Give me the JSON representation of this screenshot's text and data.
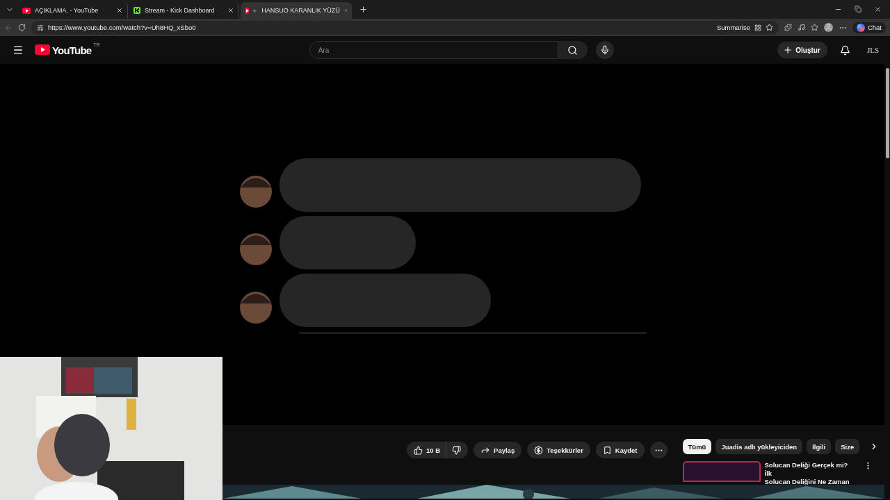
{
  "browser": {
    "tabs": [
      {
        "title": "AÇIKLAMA. - YouTube",
        "kind": "youtube",
        "selected": false,
        "audio": false
      },
      {
        "title": "Stream - Kick Dashboard",
        "kind": "kick",
        "selected": false,
        "audio": false
      },
      {
        "title": "HANSUO KARANLIK YÜZÜ",
        "kind": "youtube",
        "selected": true,
        "audio": true
      }
    ],
    "url": "https://www.youtube.com/watch?v=Uh8HQ_xSbo0",
    "summarise": "Summarise",
    "chat": "Chat"
  },
  "header": {
    "logo": "YouTube",
    "region": "TR",
    "search": {
      "placeholder": "Ara"
    },
    "create": "Oluştur",
    "account": "JLS"
  },
  "actions": {
    "likes": "10 B",
    "share": "Paylaş",
    "thanks": "Teşekkürler",
    "save": "Kaydet"
  },
  "chips": [
    {
      "label": "Tümü",
      "selected": true
    },
    {
      "label": "Juadis adlı yükleyiciden",
      "selected": false
    },
    {
      "label": "İlgili",
      "selected": false
    },
    {
      "label": "Size",
      "selected": false
    }
  ],
  "recommendation": {
    "title_lines": [
      "Solucan Deliği Gerçek mi? İlk",
      "Solucan Deliğini Ne Zaman"
    ]
  }
}
